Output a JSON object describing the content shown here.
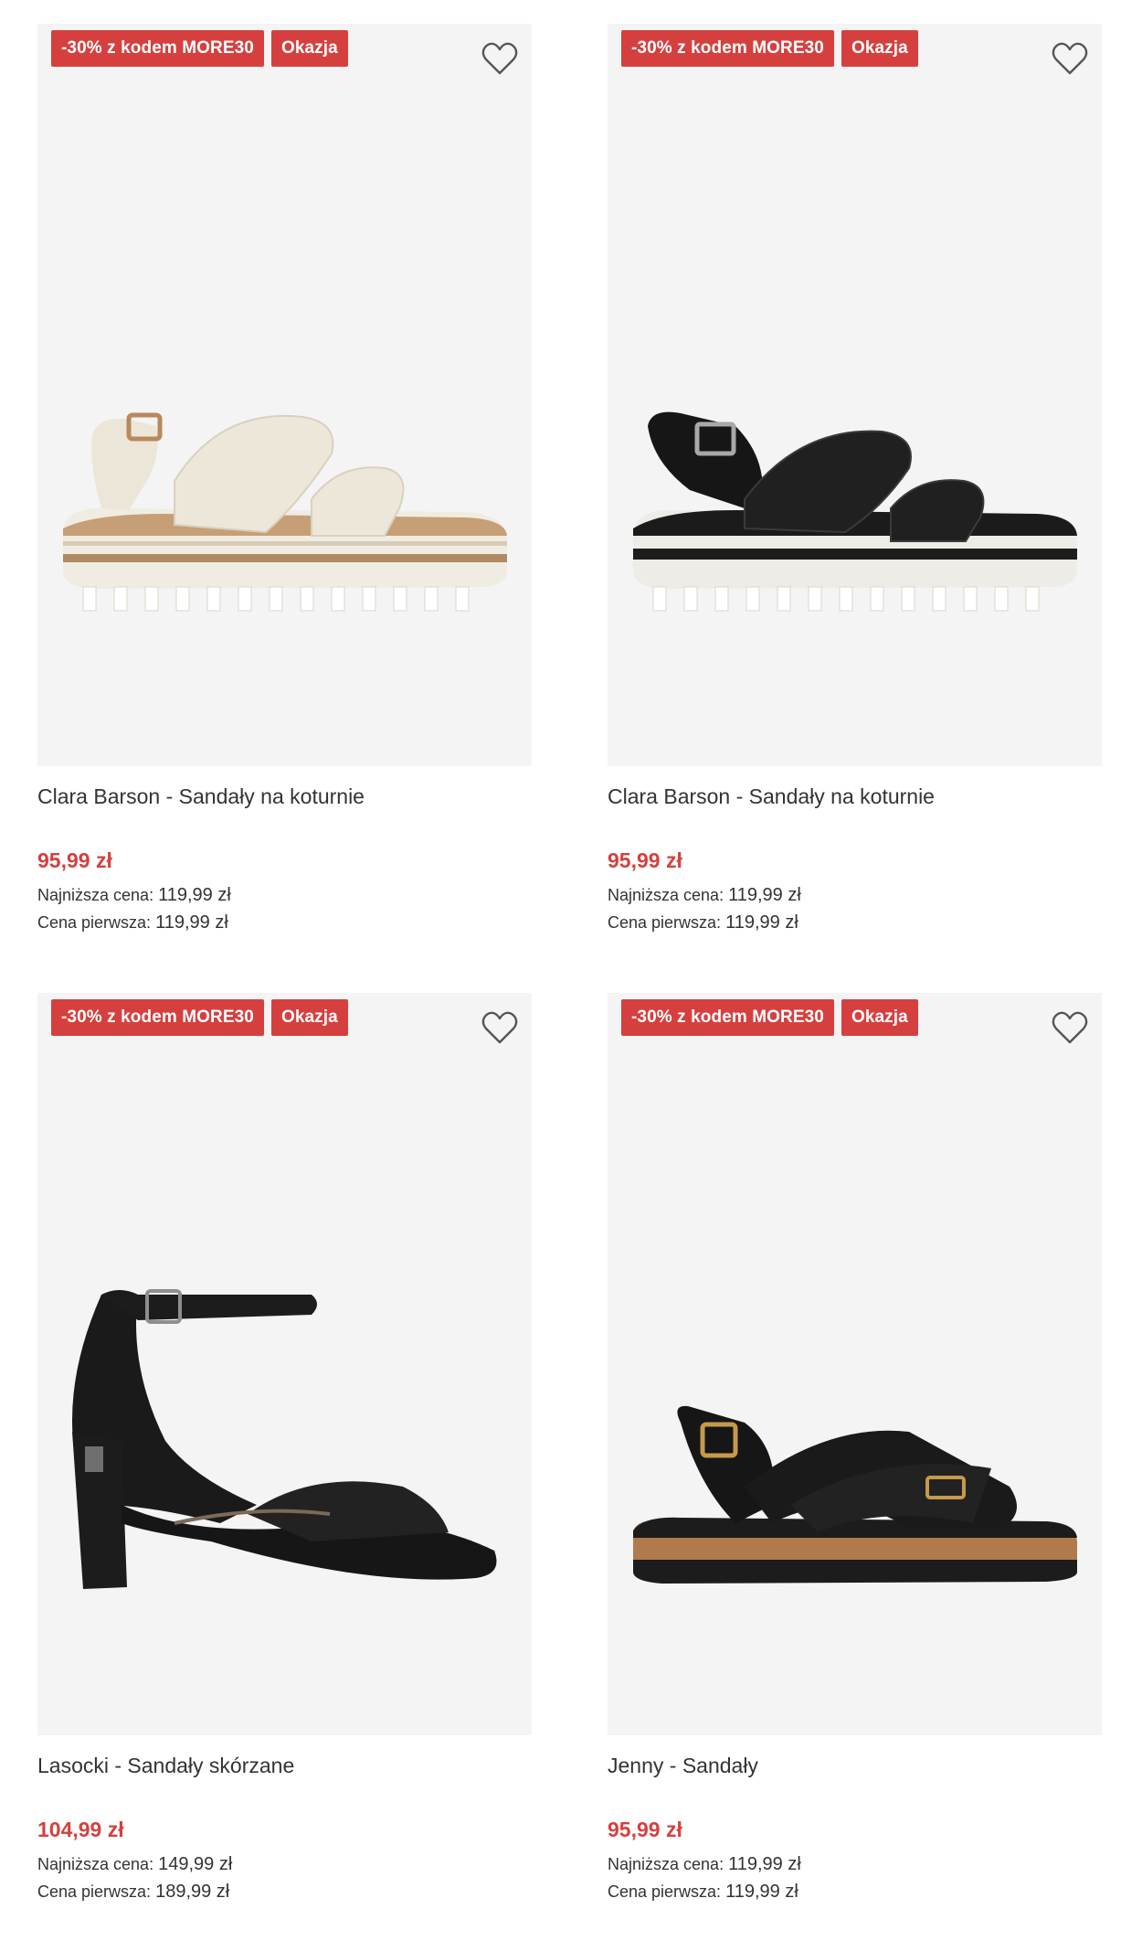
{
  "products": [
    {
      "badges": [
        "-30% z kodem MORE30",
        "Okazja"
      ],
      "name": "Clara Barson - Sandały na koturnie",
      "price": "95,99 zł",
      "lowest_label": "Najniższa cena:",
      "lowest_value": "119,99 zł",
      "first_label": "Cena pierwsza:",
      "first_value": "119,99 zł",
      "image": "cream-woven-wedge-sandal"
    },
    {
      "badges": [
        "-30% z kodem MORE30",
        "Okazja"
      ],
      "name": "Clara Barson - Sandały na koturnie",
      "price": "95,99 zł",
      "lowest_label": "Najniższa cena:",
      "lowest_value": "119,99 zł",
      "first_label": "Cena pierwsza:",
      "first_value": "119,99 zł",
      "image": "black-woven-wedge-sandal"
    },
    {
      "badges": [
        "-30% z kodem MORE30",
        "Okazja"
      ],
      "name": "Lasocki - Sandały skórzane",
      "price": "104,99 zł",
      "lowest_label": "Najniższa cena:",
      "lowest_value": "149,99 zł",
      "first_label": "Cena pierwsza:",
      "first_value": "189,99 zł",
      "image": "black-heeled-sandal"
    },
    {
      "badges": [
        "-30% z kodem MORE30",
        "Okazja"
      ],
      "name": "Jenny - Sandały",
      "price": "95,99 zł",
      "lowest_label": "Najniższa cena:",
      "lowest_value": "119,99 zł",
      "first_label": "Cena pierwsza:",
      "first_value": "119,99 zł",
      "image": "black-cork-sole-sandal"
    }
  ],
  "icons": {
    "favorite": "heart-outline-icon"
  },
  "colors": {
    "badge": "#d5403f",
    "price": "#d5403f",
    "image_bg": "#f4f4f4",
    "text": "#333333"
  }
}
